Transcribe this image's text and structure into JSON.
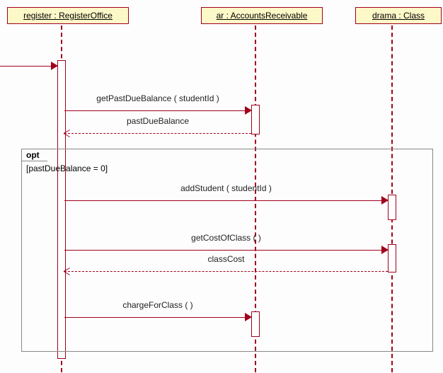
{
  "lifelines": {
    "register": {
      "label": "register : RegisterOffice"
    },
    "ar": {
      "label": "ar : AccountsReceivable"
    },
    "drama": {
      "label": "drama : Class"
    }
  },
  "messages": {
    "getPastDue": "getPastDueBalance ( studentId )",
    "pastDueBalance": "pastDueBalance",
    "addStudent": "addStudent ( studentId )",
    "getCost": "getCostOfClass (  )",
    "classCost": "classCost",
    "chargeForClass": "chargeForClass (  )"
  },
  "fragment": {
    "operator": "opt",
    "guard": "[pastDueBalance = 0]"
  },
  "chart_data": {
    "type": "sequence-diagram",
    "lifelines": [
      {
        "id": "register",
        "name": "register",
        "type": "RegisterOffice"
      },
      {
        "id": "ar",
        "name": "ar",
        "type": "AccountsReceivable"
      },
      {
        "id": "drama",
        "name": "drama",
        "type": "Class"
      }
    ],
    "messages": [
      {
        "from": "external",
        "to": "register",
        "kind": "found",
        "label": ""
      },
      {
        "from": "register",
        "to": "ar",
        "kind": "sync",
        "label": "getPastDueBalance ( studentId )"
      },
      {
        "from": "ar",
        "to": "register",
        "kind": "return",
        "label": "pastDueBalance"
      },
      {
        "from": "register",
        "to": "drama",
        "kind": "sync",
        "label": "addStudent ( studentId )",
        "fragment": "opt1"
      },
      {
        "from": "register",
        "to": "drama",
        "kind": "sync",
        "label": "getCostOfClass (  )",
        "fragment": "opt1"
      },
      {
        "from": "drama",
        "to": "register",
        "kind": "return",
        "label": "classCost",
        "fragment": "opt1"
      },
      {
        "from": "register",
        "to": "ar",
        "kind": "sync",
        "label": "chargeForClass (  )",
        "fragment": "opt1"
      }
    ],
    "fragments": [
      {
        "id": "opt1",
        "operator": "opt",
        "guard": "pastDueBalance = 0"
      }
    ]
  }
}
